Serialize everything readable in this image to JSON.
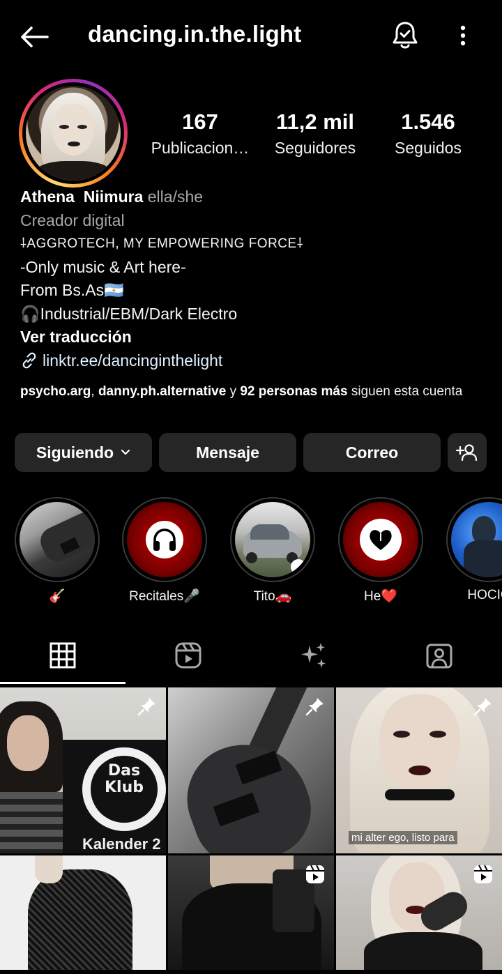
{
  "header": {
    "username": "dancing.in.the.light"
  },
  "stats": [
    {
      "value": "167",
      "label": "Publicacion…"
    },
    {
      "value": "11,2 mil",
      "label": "Seguidores"
    },
    {
      "value": "1.546",
      "label": "Seguidos"
    }
  ],
  "bio": {
    "name": "Athena  Niimura",
    "pronouns": "ella/she",
    "category": "Creador digital",
    "lines": [
      "⸸AGGROTECH, MY EMPOWERING FORCE⸸",
      "-Only music & Art here-",
      "From Bs.As🇦🇷",
      "🎧Industrial/EBM/Dark Electro"
    ],
    "translate": "Ver traducción",
    "link": "linktr.ee/dancinginthelight"
  },
  "followed_by": {
    "user1": "psycho.arg",
    "sep": ", ",
    "user2": "danny.ph.alternative",
    "y": " y ",
    "others": "92 personas más",
    "suffix": " siguen esta cuenta"
  },
  "buttons": {
    "following": "Siguiendo",
    "message": "Mensaje",
    "email": "Correo"
  },
  "highlights": [
    {
      "label": "🎸"
    },
    {
      "label": "Recitales🎤"
    },
    {
      "label": "Tito🚗"
    },
    {
      "label": "He❤️"
    },
    {
      "label": "HOCIC"
    }
  ],
  "grid": {
    "tile1_text_1": "Das",
    "tile1_text_2": "Klub",
    "tile1_text_3": "Kalender 2",
    "tile3_caption": "mi alter ego, listo para"
  },
  "colors": {
    "background": "#000000",
    "button_bg": "#262626",
    "muted_text": "#a8a8a8",
    "link_text": "#e0f1ff"
  }
}
